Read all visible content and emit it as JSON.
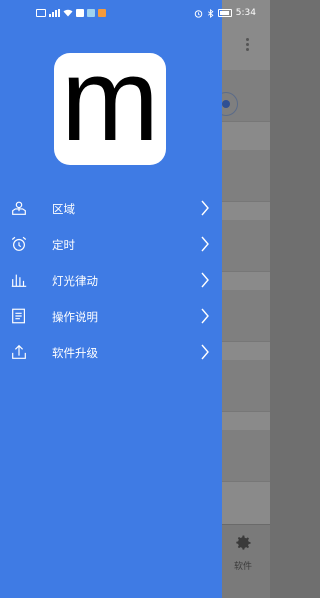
{
  "status_bar": {
    "time": "5:34",
    "icons": [
      "sim-icon",
      "signal-icon",
      "wifi-icon",
      "notification-icons",
      "alarm-icon",
      "bluetooth-icon",
      "battery-icon"
    ]
  },
  "background_app": {
    "bottom_nav_label": "软件"
  },
  "drawer": {
    "logo_letter": "m",
    "menu": [
      {
        "label": "区域",
        "icon": "map-pin-icon"
      },
      {
        "label": "定时",
        "icon": "alarm-clock-icon"
      },
      {
        "label": "灯光律动",
        "icon": "equalizer-icon"
      },
      {
        "label": "操作说明",
        "icon": "document-icon"
      },
      {
        "label": "软件升级",
        "icon": "upload-icon"
      }
    ]
  },
  "colors": {
    "drawer_bg": "#3f7be4",
    "text": "#ffffff",
    "overlay": "#8a8a8a"
  }
}
